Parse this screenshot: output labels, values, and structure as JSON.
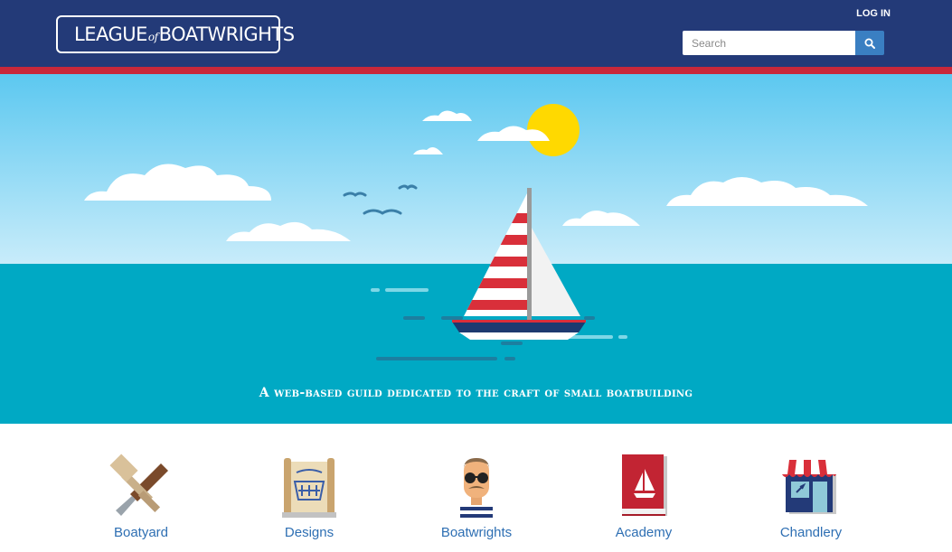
{
  "header": {
    "logo_text_left": "LEAGUE",
    "logo_text_of": "of",
    "logo_text_right": "BOATWRIGHTS",
    "login_label": "LOG IN",
    "search_placeholder": "Search"
  },
  "hero": {
    "tagline": "A web-based guild dedicated to the craft of small boatbuilding"
  },
  "features": [
    {
      "label": "Boatyard",
      "icon": "mallet-chisel-icon"
    },
    {
      "label": "Designs",
      "icon": "blueprint-scroll-icon"
    },
    {
      "label": "Boatwrights",
      "icon": "boatwright-avatar-icon"
    },
    {
      "label": "Academy",
      "icon": "book-icon"
    },
    {
      "label": "Chandlery",
      "icon": "shop-icon"
    }
  ],
  "colors": {
    "header_bg": "#233a78",
    "accent_red": "#c8283a",
    "search_button": "#3a7fc2",
    "sea": "#00a9c4",
    "sky": "#5cc8f0",
    "link": "#2e6fb3"
  }
}
